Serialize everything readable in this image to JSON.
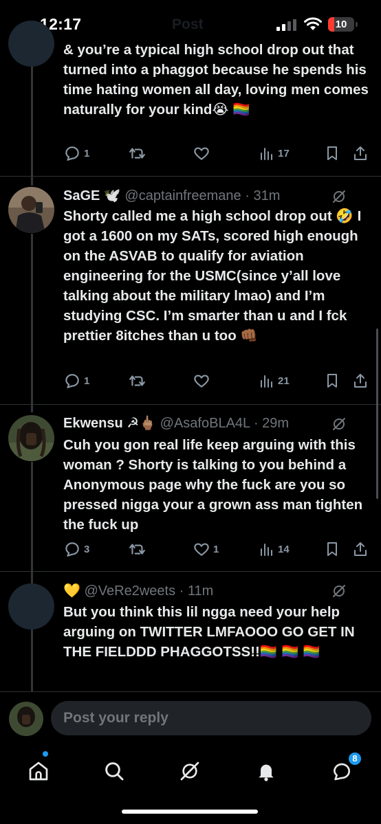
{
  "status": {
    "time": "12:17",
    "battery": "10",
    "ghost_title": "Post"
  },
  "posts": [
    {
      "text": "& you’re a typical high school drop out that turned into a phaggot because he spends his time hating women all day, loving men comes naturally for your kind😭 🏳️‍🌈",
      "actions": {
        "replies": "1",
        "reposts": "",
        "likes": "",
        "views": "17"
      }
    },
    {
      "name": "SaGE 🕊️",
      "handle": "@captainfreemane · 31m",
      "text": "Shorty called me a high school drop out 🤣 I got a 1600 on my SATs, scored high enough on the ASVAB to qualify for aviation engineering for the USMC(since y’all love talking about the military lmao) and I’m studying CSC. I’m smarter than u and I fck prettier 8itches than u too 👊🏾",
      "actions": {
        "replies": "1",
        "reposts": "",
        "likes": "",
        "views": "21"
      }
    },
    {
      "name": "Ekwensu ☭🖕🏽",
      "handle": "@AsafoBLA4L · 29m",
      "text": "Cuh you gon real life keep arguing with this woman ? Shorty is talking to you behind a Anonymous page why the fuck are you so pressed nigga your a grown ass man tighten the fuck up",
      "actions": {
        "replies": "3",
        "reposts": "",
        "likes": "1",
        "views": "14"
      }
    },
    {
      "name": "💛",
      "handle": "@VeRe2weets · 11m",
      "text": "But you think this lil ngga need your help arguing on TWITTER LMFAOOO GO GET IN THE FIELDDD PHAGGOTSS!!🏳️‍🌈 🏳️‍🌈 🏳️‍🌈"
    }
  ],
  "reply": {
    "placeholder": "Post your reply"
  },
  "tabbar": {
    "notifications_badge": "8"
  },
  "colors": {
    "accent": "#1d9bf0",
    "muted": "#71767b",
    "text": "#e7e9ea",
    "background": "#000000"
  }
}
